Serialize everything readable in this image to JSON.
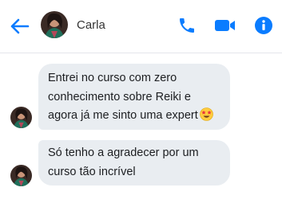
{
  "header": {
    "contact_name": "Carla",
    "back_icon": "arrow-left-icon",
    "call_icon": "phone-icon",
    "video_icon": "video-camera-icon",
    "info_icon": "info-icon",
    "accent_color": "#0a7cff"
  },
  "messages": [
    {
      "lines": [
        "Entrei no curso com zero",
        "conhecimento sobre Reiki e",
        "agora já me sinto uma expert"
      ],
      "emoji": "star-struck-emoji"
    },
    {
      "lines": [
        "Só tenho a agradecer por um",
        "curso tão incrível"
      ]
    }
  ],
  "colors": {
    "bubble_background": "#e9edf1",
    "divider": "#e4e6eb"
  }
}
